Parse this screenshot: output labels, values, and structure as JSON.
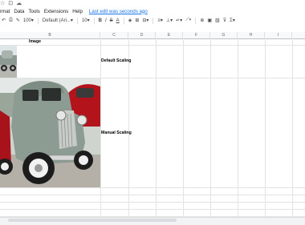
{
  "menu": {
    "items": [
      "rmat",
      "Data",
      "Tools",
      "Extensions",
      "Help"
    ],
    "last_edit": "Last edit was seconds ago"
  },
  "toolbar": {
    "zoom": "100",
    "font": "Default (Ari...",
    "font_size": "10",
    "bold": "B",
    "italic": "I",
    "strike": "S",
    "text_color": "A"
  },
  "columns": [
    "B",
    "C",
    "D",
    "E",
    "F",
    "G",
    "H",
    "I"
  ],
  "cells": {
    "header_image": "Image",
    "default_scaling": "Default Scaling",
    "manual_scaling": "Manual Scaling"
  },
  "colors": {
    "link": "#1a73e8",
    "grid": "#e2e3e3",
    "header_bg": "#f8f9fa"
  }
}
